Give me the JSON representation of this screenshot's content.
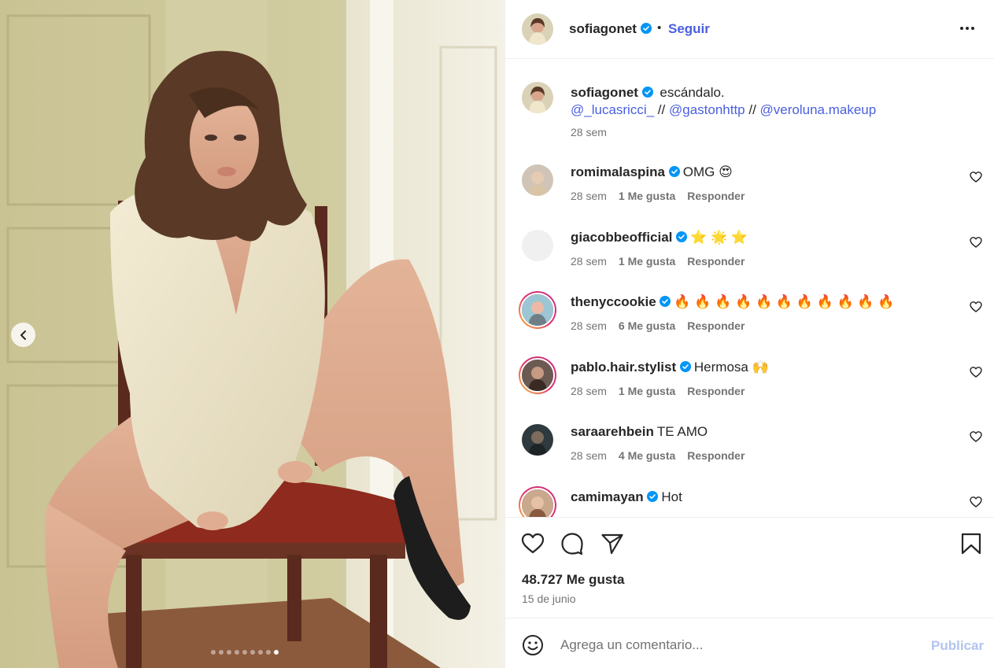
{
  "post": {
    "author": "sofiagonet",
    "follow_label": "Seguir",
    "separator": "•",
    "caption_text": "escándalo.",
    "caption_mentions": [
      "@_lucasricci_",
      "@gastonhttp",
      "@veroluna.makeup"
    ],
    "caption_separator": " // ",
    "caption_time": "28 sem",
    "likes_count": "48.727 Me gusta",
    "date": "15 de junio",
    "carousel": {
      "total_slides": 9,
      "active_slide": 9
    }
  },
  "comments": [
    {
      "user": "romimalaspina",
      "verified": true,
      "text": "OMG 😍",
      "time": "28 sem",
      "likes": "1 Me gusta",
      "reply": "Responder",
      "story_ring": false
    },
    {
      "user": "giacobbeofficial",
      "verified": true,
      "text": "⭐ 🌟 ⭐",
      "time": "28 sem",
      "likes": "1 Me gusta",
      "reply": "Responder",
      "story_ring": false
    },
    {
      "user": "thenyccookie",
      "verified": true,
      "text": "🔥 🔥 🔥 🔥 🔥 🔥 🔥 🔥 🔥 🔥 🔥",
      "time": "28 sem",
      "likes": "6 Me gusta",
      "reply": "Responder",
      "story_ring": true
    },
    {
      "user": "pablo.hair.stylist",
      "verified": true,
      "text": "Hermosa 🙌",
      "time": "28 sem",
      "likes": "1 Me gusta",
      "reply": "Responder",
      "story_ring": true
    },
    {
      "user": "saraarehbein",
      "verified": false,
      "text": "TE AMO",
      "time": "28 sem",
      "likes": "4 Me gusta",
      "reply": "Responder",
      "story_ring": false
    },
    {
      "user": "camimayan",
      "verified": true,
      "text": "Hot",
      "time": "",
      "likes": "",
      "reply": "",
      "story_ring": true
    }
  ],
  "composer": {
    "placeholder": "Agrega un comentario...",
    "submit_label": "Publicar"
  },
  "icons": {
    "verified": "verified-badge-icon",
    "more": "more-options-icon",
    "like": "heart-icon",
    "comment": "comment-bubble-icon",
    "share": "paper-plane-icon",
    "save": "bookmark-icon",
    "emoji": "emoji-smiley-icon",
    "prev": "chevron-left-icon"
  },
  "colors": {
    "link": "#4a5fe0",
    "verified": "#0095f6",
    "muted": "#737373",
    "publish_disabled": "#b2c4ee"
  }
}
